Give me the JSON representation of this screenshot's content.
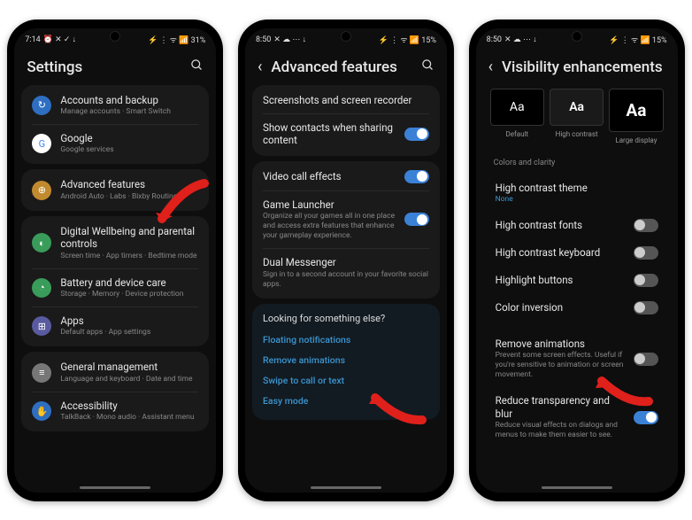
{
  "phone1": {
    "status": {
      "time": "7:14",
      "icons": "⏰ ✕ ✓ ↓",
      "right": "⚡ ⋮ ᯤ 📶 31%"
    },
    "title": "Settings",
    "groups": [
      {
        "items": [
          {
            "icon": "↻",
            "color": "#2e6fc2",
            "title": "Accounts and backup",
            "sub": "Manage accounts · Smart Switch"
          },
          {
            "icon": "G",
            "color": "#fff",
            "title": "Google",
            "sub": "Google services"
          }
        ]
      },
      {
        "items": [
          {
            "icon": "⊕",
            "color": "#c28a2e",
            "title": "Advanced features",
            "sub": "Android Auto · Labs · Bixby Routines"
          }
        ]
      },
      {
        "items": [
          {
            "icon": "◐",
            "color": "#3a9c5a",
            "title": "Digital Wellbeing and parental controls",
            "sub": "Screen time · App timers · Bedtime mode"
          },
          {
            "icon": "◔",
            "color": "#3a9c5a",
            "title": "Battery and device care",
            "sub": "Storage · Memory · Device protection"
          },
          {
            "icon": "⊞",
            "color": "#5a5aa0",
            "title": "Apps",
            "sub": "Default apps · App settings"
          }
        ]
      },
      {
        "items": [
          {
            "icon": "≡",
            "color": "#777",
            "title": "General management",
            "sub": "Language and keyboard · Date and time"
          },
          {
            "icon": "✋",
            "color": "#2e6fc2",
            "title": "Accessibility",
            "sub": "TalkBack · Mono audio · Assistant menu"
          }
        ]
      }
    ]
  },
  "phone2": {
    "status": {
      "time": "8:50",
      "icons": "✕ ☁ ⋯ ↓",
      "right": "⚡ ⋮ ᯤ 📶 15%"
    },
    "title": "Advanced features",
    "rows1": [
      {
        "title": "Screenshots and screen recorder",
        "sub": "",
        "toggle": null
      },
      {
        "title": "Show contacts when sharing content",
        "sub": "",
        "toggle": "on"
      }
    ],
    "rows2": [
      {
        "title": "Video call effects",
        "sub": "",
        "toggle": "on"
      },
      {
        "title": "Game Launcher",
        "sub": "Organize all your games all in one place and access extra features that enhance your gameplay experience.",
        "toggle": "on"
      },
      {
        "title": "Dual Messenger",
        "sub": "Sign in to a second account in your favorite social apps.",
        "toggle": null
      }
    ],
    "looking": "Looking for something else?",
    "links": [
      "Floating notifications",
      "Remove animations",
      "Swipe to call or text",
      "Easy mode"
    ]
  },
  "phone3": {
    "status": {
      "time": "8:50",
      "icons": "✕ ☁ ⋯ ↓",
      "right": "⚡ ⋮ ᯤ 📶 15%"
    },
    "title": "Visibility enhancements",
    "font_previews": [
      {
        "text": "Aa",
        "label": "Default",
        "cls": ""
      },
      {
        "text": "Aa",
        "label": "High contrast",
        "cls": "hc"
      },
      {
        "text": "Aa",
        "label": "Large display",
        "cls": "lg"
      }
    ],
    "section_label": "Colors and clarity",
    "rows1": [
      {
        "title": "High contrast theme",
        "sub": "None",
        "subclass": "blue",
        "toggle": null
      },
      {
        "title": "High contrast fonts",
        "sub": "",
        "toggle": "off"
      },
      {
        "title": "High contrast keyboard",
        "sub": "",
        "toggle": "off"
      },
      {
        "title": "Highlight buttons",
        "sub": "",
        "toggle": "off"
      },
      {
        "title": "Color inversion",
        "sub": "",
        "toggle": "off"
      }
    ],
    "rows2": [
      {
        "title": "Remove animations",
        "sub": "Prevent some screen effects. Useful if you're sensitive to animation or screen movement.",
        "toggle": "off"
      },
      {
        "title": "Reduce transparency and blur",
        "sub": "Reduce visual effects on dialogs and menus to make them easier to see.",
        "toggle": "on"
      }
    ]
  }
}
